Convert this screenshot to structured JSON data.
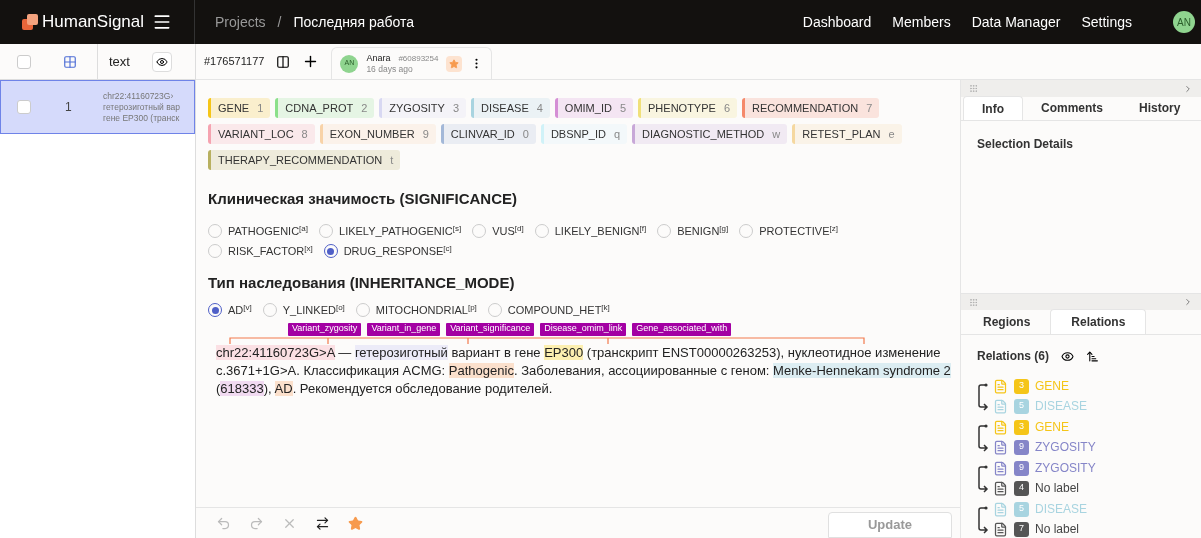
{
  "topbar": {
    "brand": "HumanSignal",
    "breadcrumb": [
      "Projects",
      "/",
      "Последняя работа"
    ],
    "nav": [
      "Dashboard",
      "Members",
      "Data Manager",
      "Settings"
    ],
    "avatar": "AN"
  },
  "task_list": {
    "all_checked": false,
    "header": "text",
    "rows": [
      {
        "id": "1",
        "lines": [
          "chr22:41160723G›",
          "гетерозиготный вар",
          "гене EP300 (транск"
        ],
        "selected": true,
        "checked": false
      }
    ]
  },
  "annotation_bar": {
    "task_id": "#176571177",
    "annotation": {
      "avatar": "AN",
      "user": "Anara",
      "id": "#60893254",
      "time": "16 days ago",
      "starred": true
    }
  },
  "labels": [
    {
      "name": "GENE",
      "hotkey": "1",
      "color": "#f5c518"
    },
    {
      "name": "CDNA_PROT",
      "hotkey": "2",
      "color": "#8be08b"
    },
    {
      "name": "ZYGOSITY",
      "hotkey": "3",
      "color": "#d8d8f2"
    },
    {
      "name": "DISEASE",
      "hotkey": "4",
      "color": "#a8d4e0"
    },
    {
      "name": "OMIM_ID",
      "hotkey": "5",
      "color": "#d58fd5"
    },
    {
      "name": "PHENOTYPE",
      "hotkey": "6",
      "color": "#f0e07a"
    },
    {
      "name": "RECOMMENDATION",
      "hotkey": "7",
      "color": "#f5896b"
    },
    {
      "name": "VARIANT_LOC",
      "hotkey": "8",
      "color": "#f5a3b0"
    },
    {
      "name": "EXON_NUMBER",
      "hotkey": "9",
      "color": "#f8d3a8"
    },
    {
      "name": "CLINVAR_ID",
      "hotkey": "0",
      "color": "#a3b8d8"
    },
    {
      "name": "DBSNP_ID",
      "hotkey": "q",
      "color": "#d0f2f8"
    },
    {
      "name": "DIAGNOSTIC_METHOD",
      "hotkey": "w",
      "color": "#c8a8d8"
    },
    {
      "name": "RETEST_PLAN",
      "hotkey": "e",
      "color": "#f5d8a0"
    },
    {
      "name": "THERAPY_RECOMMENDATION",
      "hotkey": "t",
      "color": "#b8b060"
    }
  ],
  "significance": {
    "title": "Клиническая значимость (SIGNIFICANCE)",
    "options": [
      {
        "label": "PATHOGENIC",
        "hotkey": "[a]",
        "selected": false
      },
      {
        "label": "LIKELY_PATHOGENIC",
        "hotkey": "[s]",
        "selected": false
      },
      {
        "label": "VUS",
        "hotkey": "[d]",
        "selected": false
      },
      {
        "label": "LIKELY_BENIGN",
        "hotkey": "[f]",
        "selected": false
      },
      {
        "label": "BENIGN",
        "hotkey": "[g]",
        "selected": false
      },
      {
        "label": "PROTECTIVE",
        "hotkey": "[z]",
        "selected": false
      },
      {
        "label": "RISK_FACTOR",
        "hotkey": "[x]",
        "selected": false
      },
      {
        "label": "DRUG_RESPONSE",
        "hotkey": "[c]",
        "selected": true
      }
    ]
  },
  "inheritance": {
    "title": "Тип наследования (INHERITANCE_MODE)",
    "options": [
      {
        "label": "AD",
        "hotkey": "[v]",
        "selected": true
      },
      {
        "label": "Y_LINKED",
        "hotkey": "[o]",
        "selected": false
      },
      {
        "label": "MITOCHONDRIAL",
        "hotkey": "[p]",
        "selected": false
      },
      {
        "label": "COMPOUND_HET",
        "hotkey": "[k]",
        "selected": false
      }
    ]
  },
  "relation_labels": [
    "Variant_zygosity",
    "Variant_in_gene",
    "Variant_significance",
    "Disease_omim_link",
    "Gene_associated_with"
  ],
  "text_segments": [
    {
      "text": "chr22:41160723G>A",
      "color": "#fbe0e4"
    },
    {
      "text": " — "
    },
    {
      "text": "гетерозиготный",
      "color": "#ecebf8"
    },
    {
      "text": " вариант в гене "
    },
    {
      "text": "EP300",
      "color": "#fcefb0"
    },
    {
      "text": " (транскрипт ENST00000263253), нуклеотидное изменение c.3671+1G>A. Классификация ACMG: "
    },
    {
      "text": "Pathogenic",
      "color": "#fbe0cc"
    },
    {
      "text": ". Заболевания, ассоциированные с геном: "
    },
    {
      "text": "Menke-Hennekam syndrome 2",
      "color": "#dcedf2"
    },
    {
      "text": " ("
    },
    {
      "text": "618333",
      "color": "#f1daf1"
    },
    {
      "text": "), "
    },
    {
      "text": "AD",
      "color": "#fbe0cc"
    },
    {
      "text": ". Рекомендуется обследование родителей."
    }
  ],
  "update_button": "Update",
  "info_panel": {
    "tabs": [
      {
        "label": "Info",
        "selected": true
      },
      {
        "label": "Comments",
        "selected": false
      },
      {
        "label": "History",
        "selected": false
      }
    ],
    "heading": "Selection Details"
  },
  "relations_panel": {
    "tabs": [
      {
        "label": "Regions",
        "selected": false
      },
      {
        "label": "Relations",
        "selected": true
      }
    ],
    "heading": "Relations (6)",
    "relations": [
      {
        "from": {
          "label": "GENE",
          "number": "3",
          "color": "#f5c518"
        },
        "to": {
          "label": "DISEASE",
          "number": "5",
          "color": "#a8d4e0"
        }
      },
      {
        "from": {
          "label": "GENE",
          "number": "3",
          "color": "#f5c518"
        },
        "to": {
          "label": "ZYGOSITY",
          "number": "9",
          "color": "#8585c8"
        }
      },
      {
        "from": {
          "label": "ZYGOSITY",
          "number": "9",
          "color": "#8585c8"
        },
        "to": {
          "label": "No label",
          "number": "4",
          "color": "#555555"
        }
      },
      {
        "from": {
          "label": "DISEASE",
          "number": "5",
          "color": "#a8d4e0"
        },
        "to": {
          "label": "No label",
          "number": "7",
          "color": "#555555"
        }
      }
    ]
  }
}
